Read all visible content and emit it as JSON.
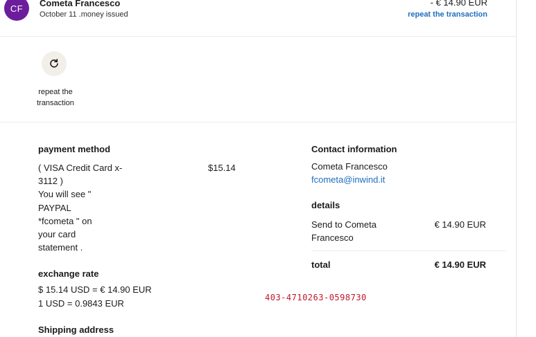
{
  "header": {
    "avatar_initials": "CF",
    "name": "Cometa Francesco",
    "subtitle": "October 11 .money  issued",
    "amount": "- € 14.90  EUR",
    "repeat_link": "repeat the transaction"
  },
  "repeat_action": {
    "label_line1": "repeat the",
    "label_line2": "transaction",
    "icon": "refresh-icon"
  },
  "payment": {
    "heading": "payment method",
    "lines": [
      "( VISA Credit Card x-",
      "3112 )",
      "You will see \"",
      "PAYPAL",
      "*fcometa \" on",
      "your card",
      "statement ."
    ],
    "amount": "$15.14"
  },
  "exchange": {
    "heading": "exchange rate",
    "line1": "$ 15.14 USD = € 14.90 EUR",
    "line2": "1 USD = 0.9843 EUR"
  },
  "shipping": {
    "heading": "Shipping address"
  },
  "contact": {
    "heading": "Contact information",
    "name": "Cometa Francesco",
    "email": "fcometa@inwind.it"
  },
  "details": {
    "heading": "details",
    "item_line1": "Send to Cometa",
    "item_line2": "Francesco",
    "item_amount": "€ 14.90 EUR",
    "total_label": "total",
    "total_amount": "€ 14.90 EUR"
  },
  "transaction_code": "403-4710263-0598730",
  "colors": {
    "avatar_bg": "#6c1d9c",
    "link": "#1f6fbf",
    "code": "#c0182a"
  }
}
